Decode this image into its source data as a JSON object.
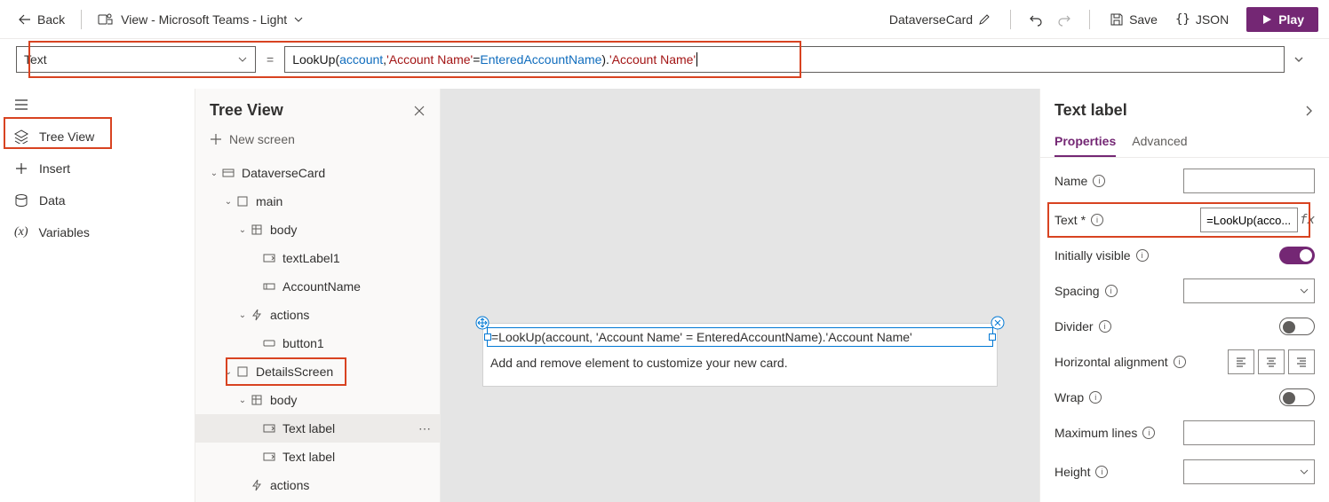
{
  "topbar": {
    "back": "Back",
    "view": "View - Microsoft Teams - Light",
    "card_name": "DataverseCard",
    "save": "Save",
    "json": "JSON",
    "play": "Play"
  },
  "formula": {
    "property": "Text",
    "tokens": {
      "fn": "LookUp",
      "lp": "(",
      "id1": "account",
      "comma": ", ",
      "str1": "'Account Name'",
      "eq": " = ",
      "id2": "EnteredAccountName",
      "rp": ").",
      "str2": "'Account Name'"
    }
  },
  "leftnav": {
    "tree_view": "Tree View",
    "insert": "Insert",
    "data": "Data",
    "variables": "Variables"
  },
  "treepanel": {
    "title": "Tree View",
    "new_screen": "New screen",
    "nodes": {
      "dataversecard": "DataverseCard",
      "main": "main",
      "body1": "body",
      "textlabel1": "textLabel1",
      "accountname": "AccountName",
      "actions1": "actions",
      "button1": "button1",
      "detailsscreen": "DetailsScreen",
      "body2": "body",
      "textlabel_a": "Text label",
      "textlabel_b": "Text label",
      "actions2": "actions"
    }
  },
  "canvas": {
    "field_value": "=LookUp(account, 'Account Name' = EnteredAccountName).'Account Name'",
    "hint": "Add and remove element to customize your new card."
  },
  "proppanel": {
    "title": "Text label",
    "tabs": {
      "properties": "Properties",
      "advanced": "Advanced"
    },
    "rows": {
      "name": "Name",
      "text": "Text *",
      "text_value": "=LookUp(acco...",
      "initially_visible": "Initially visible",
      "spacing": "Spacing",
      "divider": "Divider",
      "halign": "Horizontal alignment",
      "wrap": "Wrap",
      "maxlines": "Maximum lines",
      "height": "Height"
    }
  }
}
